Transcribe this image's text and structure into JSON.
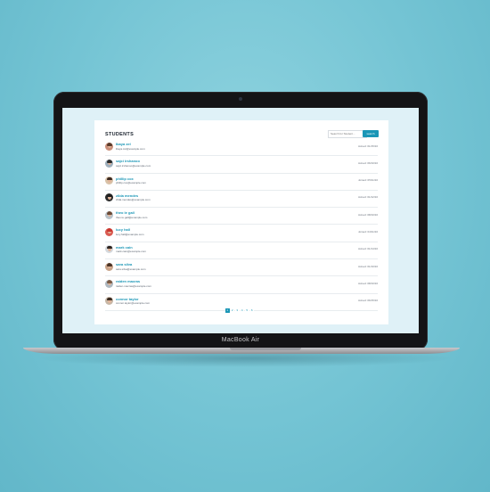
{
  "device": {
    "model": "MacBook Air"
  },
  "page": {
    "title": "STUDENTS",
    "search": {
      "placeholder": "Search for Student...",
      "button_label": "search"
    }
  },
  "students": [
    {
      "name": "Ibaya zel",
      "email": "ibaya.zel@example.com",
      "joined": "Joined: 01/15/10",
      "avatar": "female-avatar"
    },
    {
      "name": "sajci irshanoo",
      "email": "sajci.irshanoo@example.com",
      "joined": "Joined: 06/10/10",
      "avatar": "male-avatar"
    },
    {
      "name": "phillip cox",
      "email": "phillip.cox@example.com",
      "joined": "Joined: 05/11/10",
      "avatar": "male-avatar"
    },
    {
      "name": "zilda mendes",
      "email": "zilda.mendes@example.com",
      "joined": "Joined: 01/12/10",
      "avatar": "female-avatar"
    },
    {
      "name": "theo le gall",
      "email": "theo.le.gall@example.com",
      "joined": "Joined: 08/10/10",
      "avatar": "male-avatar"
    },
    {
      "name": "lucy hall",
      "email": "lucy.hall@example.com",
      "joined": "Joined: 04/11/10",
      "avatar": "female-avatar"
    },
    {
      "name": "mark cain",
      "email": "mark.cain@example.com",
      "joined": "Joined: 01/14/10",
      "avatar": "male-avatar"
    },
    {
      "name": "sara silva",
      "email": "sara.silva@example.com",
      "joined": "Joined: 01/10/10",
      "avatar": "female-avatar"
    },
    {
      "name": "raiden macras",
      "email": "raiden.macras@example.com",
      "joined": "Joined: 08/10/10",
      "avatar": "male-avatar"
    },
    {
      "name": "connor taylor",
      "email": "connor.taylor@example.com",
      "joined": "Joined: 06/15/10",
      "avatar": "male-avatar"
    }
  ],
  "pagination": {
    "pages": [
      "1",
      "2",
      "3",
      "4",
      "5",
      "6"
    ],
    "current": "1"
  },
  "colors": {
    "accent": "#1a96b6",
    "background": "#72c3d3",
    "screen": "#dff1f7"
  }
}
